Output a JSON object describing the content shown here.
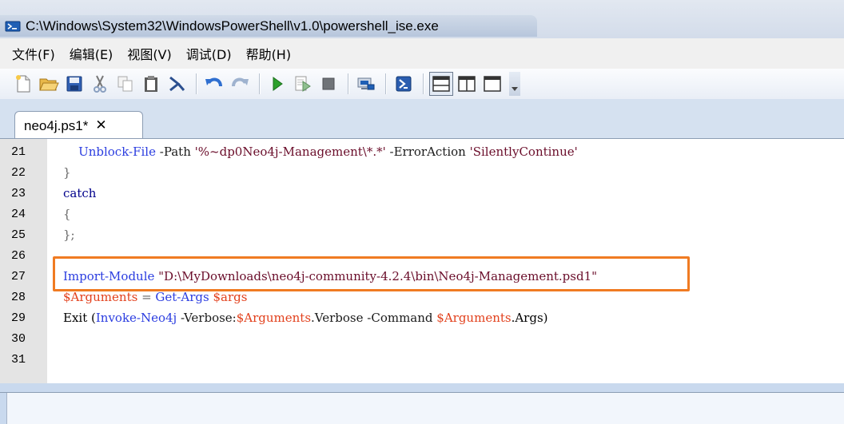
{
  "window": {
    "title": "C:\\Windows\\System32\\WindowsPowerShell\\v1.0\\powershell_ise.exe",
    "icon": "powershell-icon"
  },
  "menu": [
    {
      "label": "文件(F)"
    },
    {
      "label": "编辑(E)"
    },
    {
      "label": "视图(V)"
    },
    {
      "label": "调试(D)"
    },
    {
      "label": "帮助(H)"
    }
  ],
  "toolbar": {
    "buttons": [
      "new-file-icon",
      "open-folder-icon",
      "save-icon",
      "cut-icon",
      "copy-icon",
      "paste-icon",
      "clear-icon",
      "undo-icon",
      "redo-icon",
      "run-icon",
      "run-selection-icon",
      "stop-icon",
      "remote-powershell-icon",
      "powershell-console-icon",
      "layout-top-icon",
      "layout-right-icon",
      "layout-max-icon"
    ]
  },
  "tab": {
    "label": "neo4j.ps1*",
    "close": "✕"
  },
  "editor": {
    "lines": [
      {
        "n": "21",
        "t1": "    Unblock-File",
        "t2": " -Path ",
        "t3": "'%~dp0Neo4j-Management\\*.*'",
        "t4": " -ErrorAction ",
        "t5": "'SilentlyContinue'"
      },
      {
        "n": "22",
        "t1": "}"
      },
      {
        "n": "23",
        "t1": "catch"
      },
      {
        "n": "24",
        "t1": "{"
      },
      {
        "n": "25",
        "t1": "};"
      },
      {
        "n": "26"
      },
      {
        "n": "27",
        "t1": "Import-Module",
        "t2": " ",
        "t3": "\"D:\\MyDownloads\\neo4j-community-4.2.4\\bin\\Neo4j-Management.psd1\""
      },
      {
        "n": "28",
        "t1": "$Arguments",
        "t2": " = ",
        "t3": "Get-Args",
        "t4": " ",
        "t5": "$args"
      },
      {
        "n": "29",
        "t1": "Exit (",
        "t2": "Invoke-Neo4j",
        "t3": " -Verbose:",
        "t4": "$Arguments",
        "t5": ".Verbose -Command ",
        "t6": "$Arguments",
        "t7": ".Args)"
      },
      {
        "n": "30"
      },
      {
        "n": "31"
      }
    ]
  },
  "colors": {
    "highlight_border": "#f07b22",
    "cmdlet": "#2b3de0",
    "string": "#6a0d2a",
    "variable": "#e2401c"
  }
}
